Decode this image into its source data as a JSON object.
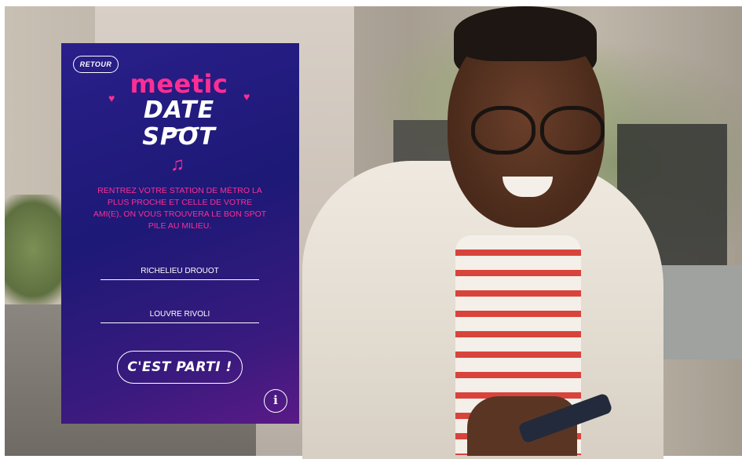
{
  "panel": {
    "back_label": "RETOUR",
    "brand": "meetic",
    "subbrand": "DATE SPOT",
    "instructions": "RENTREZ VOTRE STATION DE MÉTRO LA PLUS PROCHE ET CELLE DE VOTRE AMI(E), ON VOUS TROUVERA LE BON SPOT PILE AU MILIEU.",
    "station_1_value": "RICHELIEU DROUOT",
    "station_2_value": "LOUVRE RIVOLI",
    "submit_label": "C'EST PARTI !",
    "info_label": "i",
    "icons": {
      "back": "back-button",
      "music": "music-notes-icon",
      "heart_left": "heart-icon",
      "heart_right": "heart-icon",
      "info": "info-icon"
    }
  },
  "colors": {
    "panel_start": "#2a1f8a",
    "panel_end": "#5a1a86",
    "accent": "#ff2e94"
  }
}
